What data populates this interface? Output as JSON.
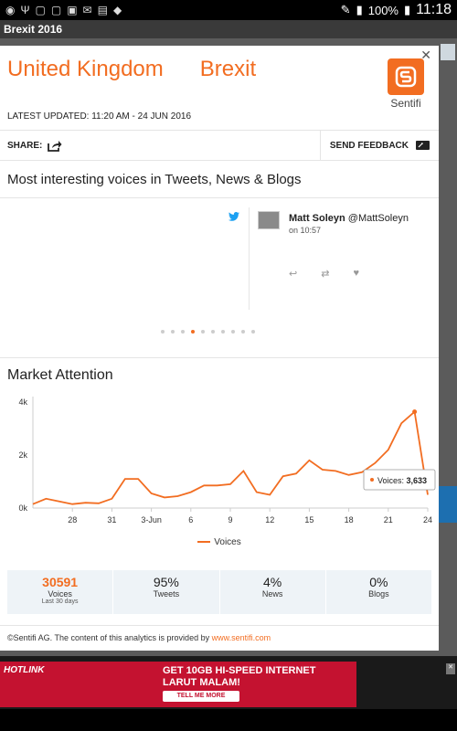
{
  "status_bar": {
    "battery": "100%",
    "time": "11:18"
  },
  "app": {
    "title": "Brexit 2016"
  },
  "modal": {
    "title_left": "United Kingdom",
    "title_right": "Brexit",
    "close_glyph": "✕",
    "logo_text": "Sentifi",
    "updated": "LATEST UPDATED: 11:20 AM - 24 JUN 2016",
    "share_label": "SHARE:",
    "feedback_label": "SEND FEEDBACK",
    "voices_title": "Most interesting voices in Tweets, News & Blogs",
    "tweet": {
      "name": "Matt Soleyn",
      "handle": "@MattSoleyn",
      "time": "on 10:57"
    },
    "carousel": {
      "count": 10,
      "active_index": 3
    },
    "market_title": "Market Attention",
    "legend_label": "Voices",
    "stats": [
      {
        "value": "30591",
        "label": "Voices",
        "sub": "Last 30 days"
      },
      {
        "value": "95%",
        "label": "Tweets"
      },
      {
        "value": "4%",
        "label": "News"
      },
      {
        "value": "0%",
        "label": "Blogs"
      }
    ],
    "footer_text": "©Sentifi AG. The content of this analytics is provided by",
    "footer_link": "www.sentifi.com"
  },
  "ad": {
    "brand": "HOTLINK",
    "headline_1": "GET 10GB HI-SPEED INTERNET",
    "headline_2": "LARUT MALAM!",
    "cta": "TELL ME MORE"
  },
  "accent_color": "#f26d21",
  "chart_data": {
    "type": "line",
    "series": [
      {
        "name": "Voices",
        "values": [
          150,
          350,
          250,
          150,
          200,
          180,
          350,
          1100,
          1100,
          550,
          400,
          450,
          600,
          850,
          850,
          900,
          1400,
          600,
          500,
          1200,
          1300,
          1800,
          1450,
          1400,
          1250,
          1350,
          1700,
          2200,
          3200,
          3633,
          500
        ]
      }
    ],
    "x_tick_labels": [
      "28",
      "31",
      "3-Jun",
      "6",
      "9",
      "12",
      "15",
      "18",
      "21",
      "24"
    ],
    "y_tick_labels": [
      "0k",
      "2k",
      "4k"
    ],
    "ylim": [
      0,
      4000
    ],
    "tooltip": {
      "label": "Voices",
      "value": "3,633"
    },
    "grid": false
  }
}
